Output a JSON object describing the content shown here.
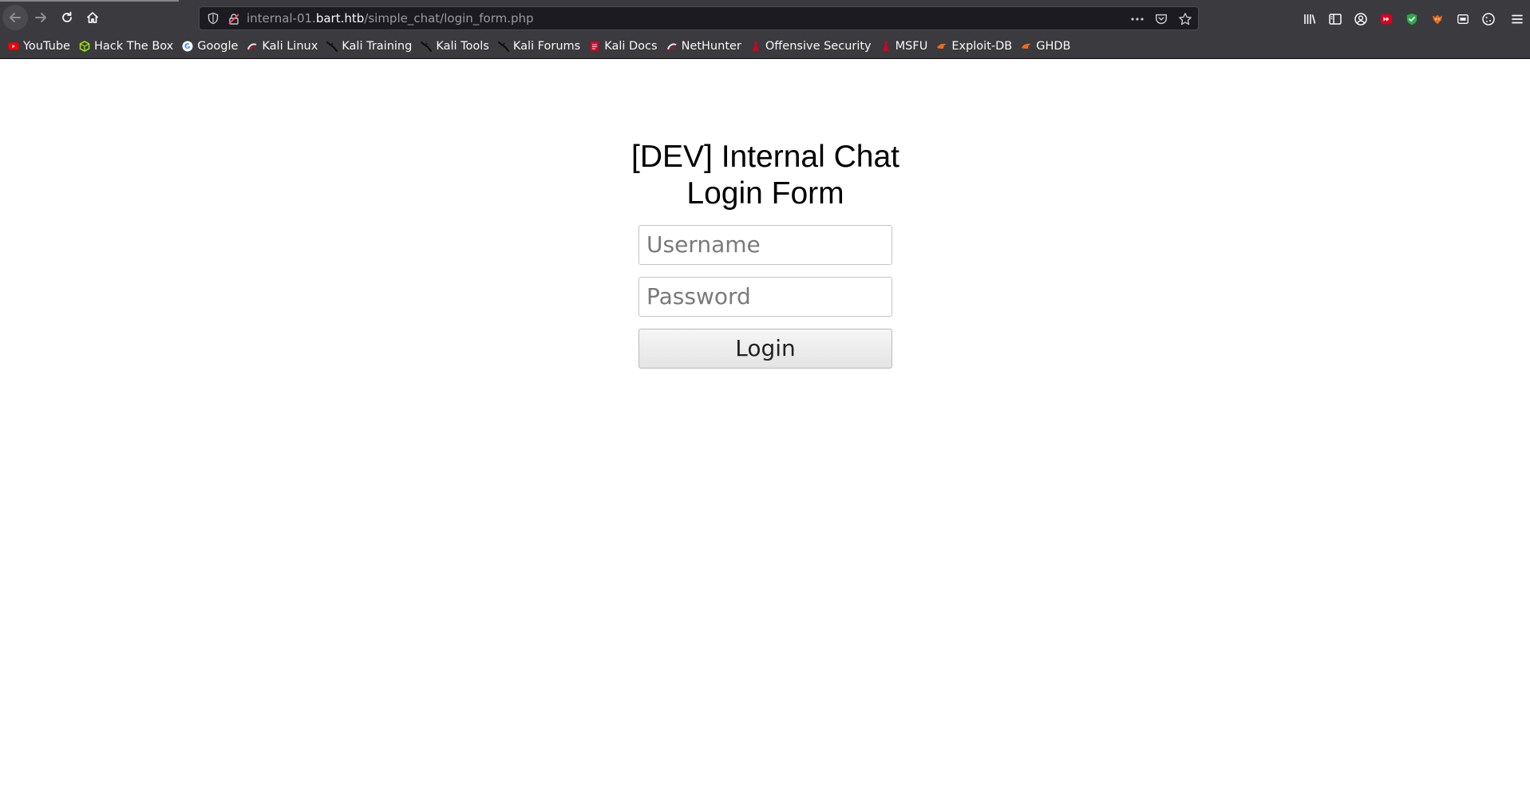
{
  "browser": {
    "url_prefix": "internal-01.",
    "url_host": "bart.htb",
    "url_path": "/simple_chat/login_form.php"
  },
  "bookmarks": [
    {
      "label": "YouTube",
      "icon": "youtube-icon"
    },
    {
      "label": "Hack The Box",
      "icon": "hackthebox-icon"
    },
    {
      "label": "Google",
      "icon": "google-icon"
    },
    {
      "label": "Kali Linux",
      "icon": "kali-icon"
    },
    {
      "label": "Kali Training",
      "icon": "kali-dragon-icon"
    },
    {
      "label": "Kali Tools",
      "icon": "kali-dragon-icon"
    },
    {
      "label": "Kali Forums",
      "icon": "kali-dragon-icon"
    },
    {
      "label": "Kali Docs",
      "icon": "kali-docs-icon"
    },
    {
      "label": "NetHunter",
      "icon": "kali-icon"
    },
    {
      "label": "Offensive Security",
      "icon": "offsec-icon"
    },
    {
      "label": "MSFU",
      "icon": "offsec-icon"
    },
    {
      "label": "Exploit-DB",
      "icon": "exploitdb-icon"
    },
    {
      "label": "GHDB",
      "icon": "exploitdb-icon"
    }
  ],
  "login": {
    "title_line1": "[DEV] Internal Chat",
    "title_line2": "Login Form",
    "username_placeholder": "Username",
    "password_placeholder": "Password",
    "login_label": "Login"
  },
  "colors": {
    "chrome": "#3b3b3f",
    "urlbar": "#1c1b22",
    "page": "#ffffff"
  }
}
